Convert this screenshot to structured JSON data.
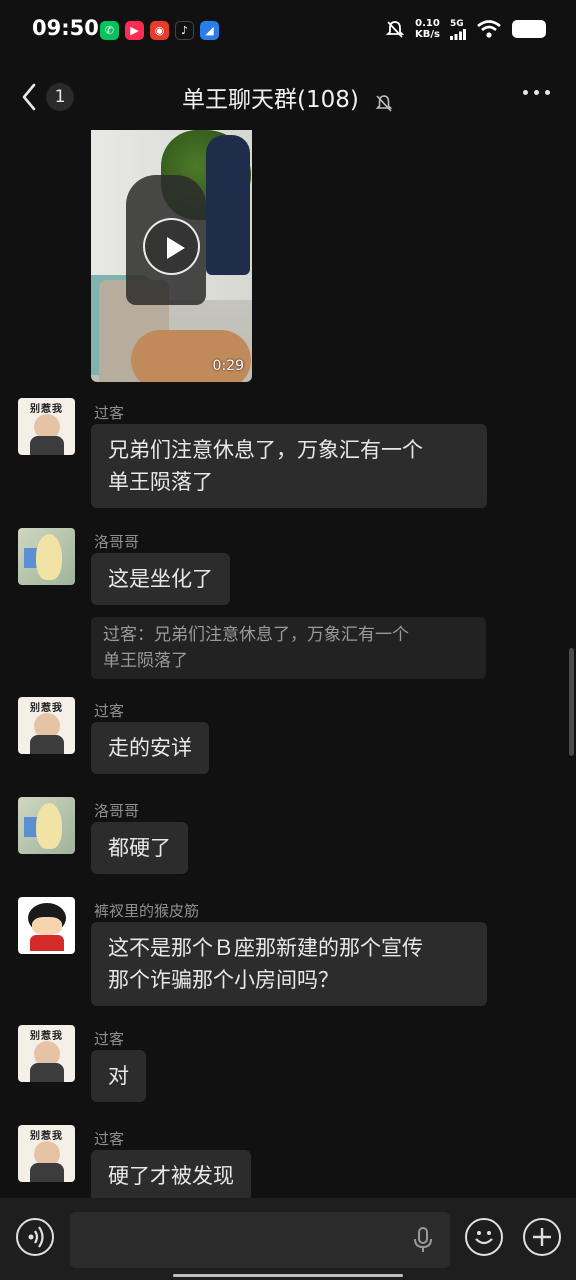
{
  "status_bar": {
    "time": "09:50",
    "net_speed_value": "0.10",
    "net_speed_unit": "KB/s",
    "network": "5G",
    "apps": [
      "wechat",
      "video-app",
      "red-app",
      "tiktok",
      "blue-app"
    ]
  },
  "header": {
    "back_count": "1",
    "title": "单王聊天群(108)",
    "muted": true
  },
  "video": {
    "duration": "0:29"
  },
  "messages": [
    {
      "sender": "过客",
      "text_line1": "兄弟们注意休息了，万象汇有一个",
      "text_line2": "单王陨落了"
    },
    {
      "sender": "洛哥哥",
      "text": "这是坐化了",
      "quote_line1": "过客：兄弟们注意休息了，万象汇有一个",
      "quote_line2": "单王陨落了"
    },
    {
      "sender": "过客",
      "text": "走的安详"
    },
    {
      "sender": "洛哥哥",
      "text": "都硬了"
    },
    {
      "sender": "裤衩里的猴皮筋",
      "text_line1": "这不是那个Ｂ座那新建的那个宣传",
      "text_line2": "那个诈骗那个小房间吗？"
    },
    {
      "sender": "过客",
      "text": "对"
    },
    {
      "sender": "过客",
      "text": "硬了才被发现"
    }
  ],
  "avatar_labels": {
    "baby": "别惹我"
  },
  "colors": {
    "background": "#111111",
    "bubble": "#2c2c2c",
    "quote": "#222222",
    "sender": "#8f8f8f"
  }
}
